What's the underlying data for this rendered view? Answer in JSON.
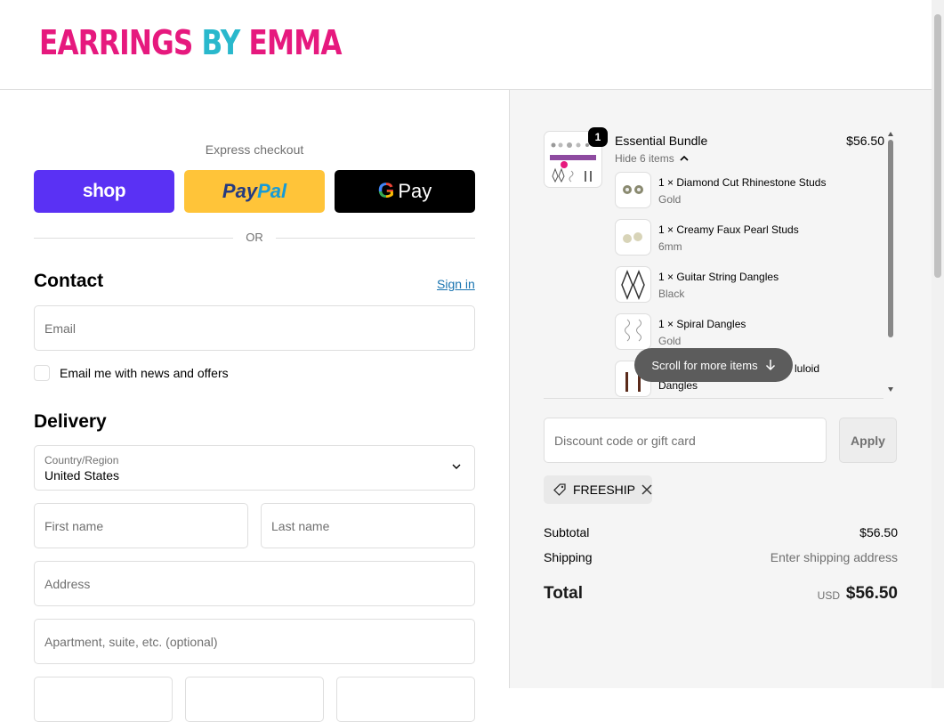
{
  "header": {
    "logo_part1": "EARRINGS ",
    "logo_part2": "BY ",
    "logo_part3": "EMMA"
  },
  "express": {
    "label": "Express checkout",
    "shop": "shop",
    "paypal_1": "Pay",
    "paypal_2": "Pal",
    "gpay_g": "G",
    "gpay_text": "Pay",
    "or": "OR"
  },
  "contact": {
    "title": "Contact",
    "signin": "Sign in",
    "email_placeholder": "Email",
    "newsletter_label": "Email me with news and offers"
  },
  "delivery": {
    "title": "Delivery",
    "country_label": "Country/Region",
    "country_value": "United States",
    "first_name": "First name",
    "last_name": "Last name",
    "address": "Address",
    "apartment": "Apartment, suite, etc. (optional)"
  },
  "order": {
    "bundle_name": "Essential Bundle",
    "bundle_price": "$56.50",
    "quantity": "1",
    "hide_items": "Hide 6 items",
    "items": [
      {
        "name": "1 × Diamond Cut Rhinestone Studs",
        "variant": "Gold"
      },
      {
        "name": "1 × Creamy Faux Pearl Studs",
        "variant": "6mm"
      },
      {
        "name": "1 × Guitar String Dangles",
        "variant": "Black"
      },
      {
        "name": "1 × Spiral Dangles",
        "variant": "Gold"
      },
      {
        "name_visible": "luloid",
        "name_line2": "Dangles"
      }
    ],
    "scroll_hint": "Scroll for more items"
  },
  "discount": {
    "placeholder": "Discount code or gift card",
    "apply": "Apply",
    "applied_code": "FREESHIP"
  },
  "summary": {
    "subtotal_label": "Subtotal",
    "subtotal_value": "$56.50",
    "shipping_label": "Shipping",
    "shipping_value": "Enter shipping address",
    "total_label": "Total",
    "currency": "USD",
    "total_value": "$56.50"
  },
  "colors": {
    "brand_pink": "#e6197e",
    "brand_teal": "#29b8cc",
    "shop_purple": "#5a31f4",
    "paypal_yellow": "#ffc439",
    "link_blue": "#1773b0"
  }
}
